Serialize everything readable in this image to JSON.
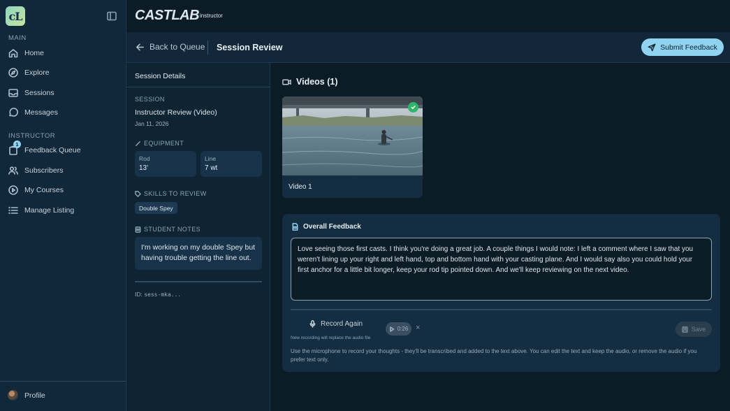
{
  "app": {
    "logo_text": "cL",
    "brand": "CASTLAB",
    "brand_sub": "instructor"
  },
  "sidebar": {
    "main_label": "MAIN",
    "instructor_label": "INSTRUCTOR",
    "main_items": [
      {
        "label": "Home",
        "icon": "home-icon"
      },
      {
        "label": "Explore",
        "icon": "compass-icon"
      },
      {
        "label": "Sessions",
        "icon": "inbox-icon"
      },
      {
        "label": "Messages",
        "icon": "chat-icon"
      }
    ],
    "instructor_items": [
      {
        "label": "Feedback Queue",
        "icon": "clipboard-icon",
        "badge": "1"
      },
      {
        "label": "Subscribers",
        "icon": "users-icon"
      },
      {
        "label": "My Courses",
        "icon": "play-circle-icon"
      },
      {
        "label": "Manage Listing",
        "icon": "list-icon"
      }
    ],
    "profile_label": "Profile"
  },
  "header": {
    "back_label": "Back to Queue",
    "title": "Session Review",
    "submit_label": "Submit Feedback"
  },
  "details": {
    "heading": "Session Details",
    "session_label": "SESSION",
    "session_name": "Instructor Review (Video)",
    "session_date": "Jan 11, 2026",
    "equipment_label": "EQUIPMENT",
    "rod_label": "Rod",
    "rod_value": "13'",
    "line_label": "Line",
    "line_value": "7 wt",
    "skills_label": "SKILLS TO REVIEW",
    "skill": "Double Spey",
    "notes_label": "STUDENT NOTES",
    "notes": "I'm working on my double Spey but having trouble getting the line out.",
    "id_prefix": "ID: ",
    "id_value": "sess-mka..."
  },
  "videos": {
    "heading": "Videos (1)",
    "items": [
      {
        "label": "Video 1"
      }
    ]
  },
  "feedback": {
    "heading": "Overall Feedback",
    "text": "Love seeing those first casts. I think you're doing a great job. A couple things I would note: I left a comment where I saw that you weren't lining up your right and left hand, top and bottom hand with your casting plane. And I would say also you could hold your first anchor for a little bit longer, keep your rod tip pointed down. And we'll keep reviewing on the next video.",
    "record_label": "Record Again",
    "record_note": "New recording will replace the audio file",
    "audio_duration": "0:26",
    "remove_symbol": "×",
    "save_label": "Save",
    "help": "Use the microphone to record your thoughts - they'll be transcribed and added to the text above. You can edit the text and keep the audio, or remove the audio if you prefer text only."
  },
  "colors": {
    "accent": "#8fd3f0",
    "background": "#0b1c26",
    "sidebar": "#11273a",
    "success": "#2fb56a"
  }
}
